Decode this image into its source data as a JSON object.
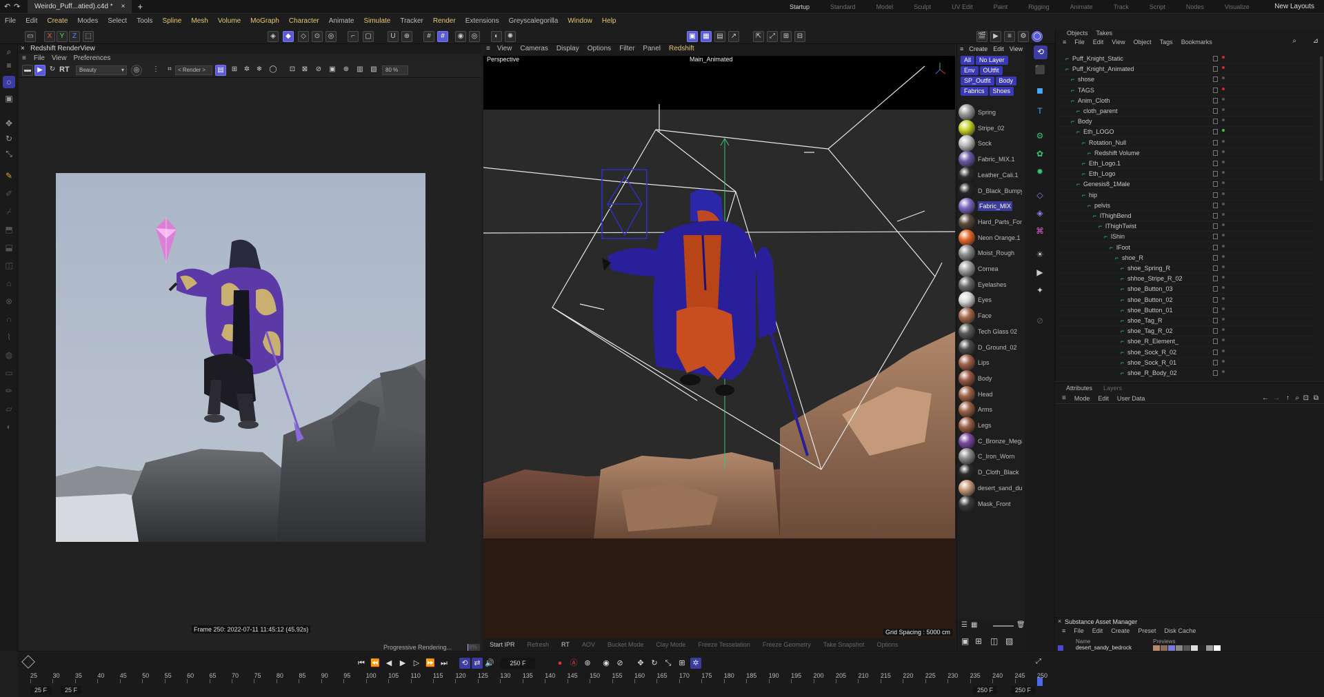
{
  "tab": {
    "title": "Weirdo_Puff...atied).c4d *",
    "add": "+"
  },
  "menu": [
    {
      "label": "File",
      "hl": false
    },
    {
      "label": "Edit",
      "hl": false
    },
    {
      "label": "Create",
      "hl": true
    },
    {
      "label": "Modes",
      "hl": false
    },
    {
      "label": "Select",
      "hl": false
    },
    {
      "label": "Tools",
      "hl": false
    },
    {
      "label": "Spline",
      "hl": true
    },
    {
      "label": "Mesh",
      "hl": true
    },
    {
      "label": "Volume",
      "hl": true
    },
    {
      "label": "MoGraph",
      "hl": true
    },
    {
      "label": "Character",
      "hl": true
    },
    {
      "label": "Animate",
      "hl": false
    },
    {
      "label": "Simulate",
      "hl": true
    },
    {
      "label": "Tracker",
      "hl": false
    },
    {
      "label": "Render",
      "hl": true
    },
    {
      "label": "Extensions",
      "hl": false
    },
    {
      "label": "Greyscalegorilla",
      "hl": false
    },
    {
      "label": "Window",
      "hl": true
    },
    {
      "label": "Help",
      "hl": true
    }
  ],
  "layouts": [
    "Startup",
    "Standard",
    "Model",
    "Sculpt",
    "UV Edit",
    "Paint",
    "Rigging",
    "Animate",
    "Track",
    "Script",
    "Nodes",
    "Visualize"
  ],
  "active_layout": "Startup",
  "new_layouts": "New Layouts",
  "axis": {
    "x": "X",
    "y": "Y",
    "z": "Z"
  },
  "renderview": {
    "title": "Redshift RenderView",
    "menu": [
      "File",
      "View",
      "Preferences"
    ],
    "rt": "RT",
    "aov": "Beauty",
    "render_mode": "< Render >",
    "zoom": "80 %",
    "info": "Frame 250:  2022-07-11  11:45:12  (45.92s)",
    "progress_label": "Progressive Rendering...",
    "progress_pct": "8%",
    "progress_value": 0.08
  },
  "viewport": {
    "menu": [
      {
        "label": "View",
        "hl": false
      },
      {
        "label": "Cameras",
        "hl": false
      },
      {
        "label": "Display",
        "hl": false
      },
      {
        "label": "Options",
        "hl": false
      },
      {
        "label": "Filter",
        "hl": false
      },
      {
        "label": "Panel",
        "hl": false
      },
      {
        "label": "Redshift",
        "hl": true
      }
    ],
    "mode": "Perspective",
    "camera": "Main_Animated",
    "grid_spacing": "Grid Spacing : 5000 cm",
    "footer": [
      {
        "label": "Start IPR",
        "on": true
      },
      {
        "label": "Refresh",
        "on": false
      },
      {
        "label": "RT",
        "on": true
      },
      {
        "label": "AOV",
        "on": false
      },
      {
        "label": "Bucket Mode",
        "on": false
      },
      {
        "label": "Clay Mode",
        "on": false
      },
      {
        "label": "Freeze Tesselation",
        "on": false
      },
      {
        "label": "Freeze Geometry",
        "on": false
      },
      {
        "label": "Take Snapshot",
        "on": false
      },
      {
        "label": "Options",
        "on": false
      }
    ]
  },
  "materials": {
    "menu": [
      "Create",
      "Edit",
      "View"
    ],
    "filters": [
      "All",
      "No Layer",
      "Env",
      "OUtfit",
      "SP_Outfit",
      "Body",
      "Fabrics",
      "Shoes"
    ],
    "items": [
      {
        "name": "Spring",
        "color": "#9a9a9a"
      },
      {
        "name": "Stripe_02",
        "color": "#c8d22a"
      },
      {
        "name": "Sock",
        "color": "#bdbdbd"
      },
      {
        "name": "Fabric_MIX.1",
        "color": "#6a5aa8"
      },
      {
        "name": "Leather_Cali.1",
        "color": "#2c2c2c"
      },
      {
        "name": "D_Black_Bumpy_l",
        "color": "#262626"
      },
      {
        "name": "Fabric_MIX",
        "color": "#7a68c0"
      },
      {
        "name": "Hard_Parts_Font",
        "color": "#5a4a3a"
      },
      {
        "name": "Neon Orange.1",
        "color": "#e86a2a"
      },
      {
        "name": "Moist_Rough",
        "color": "#8a8a8a"
      },
      {
        "name": "Cornea",
        "color": "#a0a0a0"
      },
      {
        "name": "Eyelashes",
        "color": "#6a6a6a"
      },
      {
        "name": "Eyes",
        "color": "#d8d8d8"
      },
      {
        "name": "Face",
        "color": "#a86a4a"
      },
      {
        "name": "Tech Glass 02",
        "color": "#5a5a5a"
      },
      {
        "name": "D_Ground_02",
        "color": "#4a4a4a"
      },
      {
        "name": "Lips",
        "color": "#a0604a"
      },
      {
        "name": "Body",
        "color": "#9a5a44"
      },
      {
        "name": "Head",
        "color": "#a0644a"
      },
      {
        "name": "Arms",
        "color": "#9c6248"
      },
      {
        "name": "Legs",
        "color": "#9e6046"
      },
      {
        "name": "C_Bronze_Mega_",
        "color": "#7a4aa0"
      },
      {
        "name": "C_Iron_Worn",
        "color": "#8a8a8a"
      },
      {
        "name": "D_Cloth_Black",
        "color": "#2a2a2a"
      },
      {
        "name": "desert_sand_dun",
        "color": "#c89a7a"
      },
      {
        "name": "Mask_Front",
        "color": "#3a3a3a"
      }
    ],
    "selected": "Fabric_MIX"
  },
  "objects": {
    "tabs": [
      "Objects",
      "Takes"
    ],
    "menu": [
      "File",
      "Edit",
      "View",
      "Object",
      "Tags",
      "Bookmarks"
    ],
    "rows": [
      {
        "name": "Puff_Knight_Static",
        "depth": 0,
        "dot": "r"
      },
      {
        "name": "Puff_Knight_Animated",
        "depth": 0,
        "dot": "r"
      },
      {
        "name": "shose",
        "depth": 1,
        "dot": ""
      },
      {
        "name": "TAGS",
        "depth": 1,
        "dot": "r"
      },
      {
        "name": "Anim_Cloth",
        "depth": 1,
        "dot": ""
      },
      {
        "name": "cloth_parent",
        "depth": 2,
        "dot": ""
      },
      {
        "name": "Body",
        "depth": 1,
        "dot": ""
      },
      {
        "name": "Eth_LOGO",
        "depth": 2,
        "dot": "g"
      },
      {
        "name": "Rotation_Null",
        "depth": 3,
        "dot": ""
      },
      {
        "name": "Redshift Volume",
        "depth": 4,
        "dot": ""
      },
      {
        "name": "Eth_Logo.1",
        "depth": 3,
        "dot": ""
      },
      {
        "name": "Eth_Logo",
        "depth": 3,
        "dot": ""
      },
      {
        "name": "Genesis8_1Male",
        "depth": 2,
        "dot": ""
      },
      {
        "name": "hip",
        "depth": 3,
        "dot": ""
      },
      {
        "name": "pelvis",
        "depth": 4,
        "dot": ""
      },
      {
        "name": "lThighBend",
        "depth": 5,
        "dot": ""
      },
      {
        "name": "lThighTwist",
        "depth": 6,
        "dot": ""
      },
      {
        "name": "lShin",
        "depth": 7,
        "dot": ""
      },
      {
        "name": "lFoot",
        "depth": 8,
        "dot": ""
      },
      {
        "name": "shoe_R",
        "depth": 9,
        "dot": ""
      },
      {
        "name": "shoe_Spring_R",
        "depth": 10,
        "dot": ""
      },
      {
        "name": "shhoe_Stripe_R_02",
        "depth": 10,
        "dot": ""
      },
      {
        "name": "shoe_Button_03",
        "depth": 10,
        "dot": ""
      },
      {
        "name": "shoe_Button_02",
        "depth": 10,
        "dot": ""
      },
      {
        "name": "shoe_Button_01",
        "depth": 10,
        "dot": ""
      },
      {
        "name": "shoe_Tag_R",
        "depth": 10,
        "dot": ""
      },
      {
        "name": "shoe_Tag_R_02",
        "depth": 10,
        "dot": ""
      },
      {
        "name": "shoe_R_Element_",
        "depth": 10,
        "dot": ""
      },
      {
        "name": "shoe_Sock_R_02",
        "depth": 10,
        "dot": ""
      },
      {
        "name": "shoe_Sock_R_01",
        "depth": 10,
        "dot": ""
      },
      {
        "name": "shoe_R_Body_02",
        "depth": 10,
        "dot": ""
      }
    ]
  },
  "attributes": {
    "tabs": [
      "Attributes",
      "Layers"
    ],
    "menu": [
      "Mode",
      "Edit",
      "User Data"
    ]
  },
  "substance": {
    "title": "Substance Asset Manager",
    "menu": [
      "File",
      "Edit",
      "Create",
      "Preset",
      "Disk Cache"
    ],
    "col_name": "Name",
    "col_previews": "Previews",
    "asset": "desert_sandy_bedrock"
  },
  "timeline": {
    "ticks": [
      "25",
      "30",
      "35",
      "40",
      "45",
      "50",
      "55",
      "60",
      "65",
      "70",
      "75",
      "80",
      "85",
      "90",
      "95",
      "100",
      "105",
      "110",
      "115",
      "120",
      "125",
      "130",
      "135",
      "140",
      "145",
      "150",
      "155",
      "160",
      "165",
      "170",
      "175",
      "180",
      "185",
      "190",
      "195",
      "200",
      "205",
      "210",
      "215",
      "220",
      "225",
      "230",
      "235",
      "240",
      "245",
      "250"
    ],
    "current_frame": "250 F",
    "start_a": "25 F",
    "start_b": "25 F",
    "end_a": "250 F",
    "end_b": "250 F"
  },
  "colors": {
    "accent": "#5a5ad6",
    "highlight_menu": "#e8c96a",
    "warning": "#d23a3a"
  }
}
